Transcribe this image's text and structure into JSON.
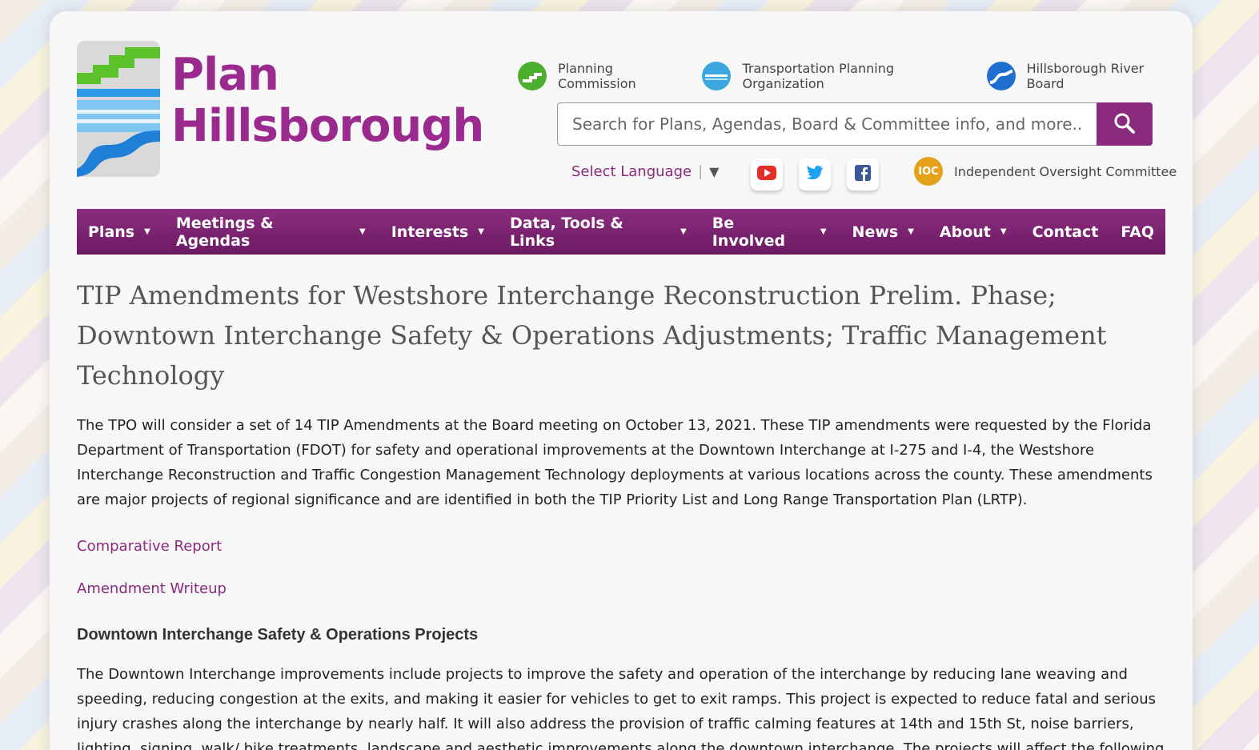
{
  "site": {
    "logo_line1": "Plan",
    "logo_line2": "Hillsborough",
    "brand_color": "#8a2a7d"
  },
  "orgs": [
    {
      "label": "Planning Commission",
      "icon": "planning-commission-logo-icon",
      "color": "#4caf2e"
    },
    {
      "label": "Transportation Planning Organization",
      "icon": "tpo-logo-icon",
      "color": "#3aa7e0"
    },
    {
      "label": "Hillsborough River Board",
      "icon": "river-board-logo-icon",
      "color": "#1f6fd0"
    }
  ],
  "search": {
    "placeholder": "Search for Plans, Agendas, Board & Committee info, and more..."
  },
  "language": {
    "label": "Select Language",
    "arrow": "▼"
  },
  "social": [
    {
      "name": "youtube-icon",
      "color": "#e52d27"
    },
    {
      "name": "twitter-icon",
      "color": "#1da1f2"
    },
    {
      "name": "facebook-icon",
      "color": "#3b5998"
    }
  ],
  "ioc": {
    "badge": "IOC",
    "label": "Independent Oversight Committee"
  },
  "nav": {
    "items": [
      {
        "label": "Plans",
        "caret": true
      },
      {
        "label": "Meetings & Agendas",
        "caret": true
      },
      {
        "label": "Interests",
        "caret": true
      },
      {
        "label": "Data, Tools & Links",
        "caret": true
      },
      {
        "label": "Be Involved",
        "caret": true
      },
      {
        "label": "News",
        "caret": true
      },
      {
        "label": "About",
        "caret": true
      },
      {
        "label": "Contact",
        "caret": false
      },
      {
        "label": "FAQ",
        "caret": false
      }
    ]
  },
  "article": {
    "title": "TIP Amendments for Westshore Interchange Reconstruction Prelim. Phase; Downtown Interchange Safety & Operations Adjustments; Traffic Management Technology",
    "intro": "The TPO will consider a set of 14 TIP Amendments at the Board meeting on October 13, 2021. These TIP amendments were requested by the Florida Department of Transportation (FDOT) for safety and operational improvements at the Downtown Interchange at I-275 and I-4, the Westshore Interchange Reconstruction and Traffic Congestion Management Technology deployments at various locations across the county. These amendments are major projects of regional significance and are identified in both the TIP Priority List and Long Range Transportation Plan (LRTP).",
    "link1": "Comparative Report",
    "link2": "Amendment Writeup",
    "section_heading": "Downtown Interchange Safety & Operations Projects",
    "section_body": "The Downtown Interchange improvements include projects to improve the safety and operation of the interchange by reducing lane weaving and speeding, reducing congestion at the exits, and making it easier for vehicles to get to exit ramps. This project is expected to reduce fatal and serious injury crashes along the interchange by nearly half. It will also address the provision of traffic calming features at 14th and 15th St, noise barriers, lighting, signing, walk/ bike treatments, landscape and aesthetic improvements along the downtown interchange. The projects will affect the following turning movements and ramps at the interchange:"
  }
}
